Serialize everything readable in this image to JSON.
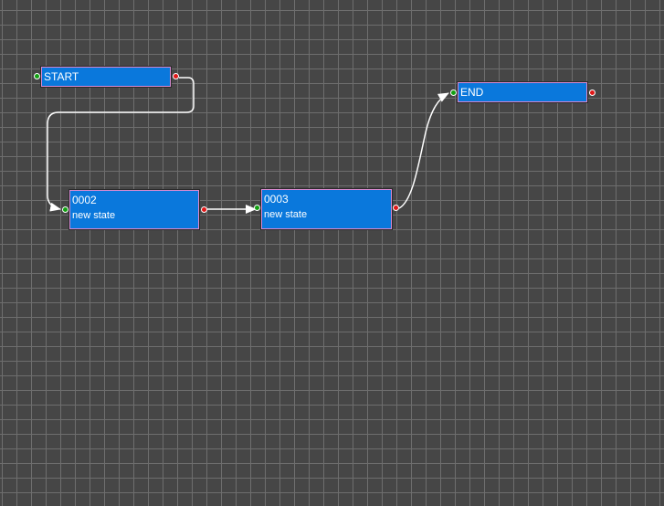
{
  "colors": {
    "canvas_background": "#464646",
    "grid_line": "#6e6e6e",
    "node_fill": "#0a78dc",
    "node_border": "#d88ad0",
    "node_text": "#ffffff",
    "input_port": "#12a012",
    "output_port": "#e01818",
    "edge": "#ffffff"
  },
  "nodes": [
    {
      "id": "start",
      "title": "START",
      "subtitle": ""
    },
    {
      "id": "n0002",
      "title": "0002",
      "subtitle": "new state"
    },
    {
      "id": "n0003",
      "title": "0003",
      "subtitle": "new state"
    },
    {
      "id": "end",
      "title": "END",
      "subtitle": ""
    }
  ],
  "edges": [
    {
      "from": "START",
      "to": "0002"
    },
    {
      "from": "0002",
      "to": "0003"
    },
    {
      "from": "0003",
      "to": "END"
    }
  ]
}
